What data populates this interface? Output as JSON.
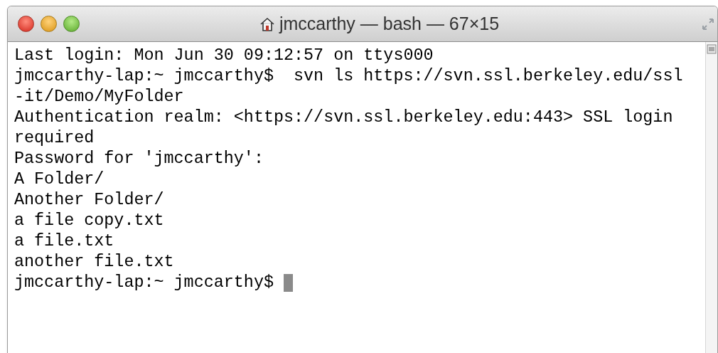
{
  "window": {
    "title": "jmccarthy — bash — 67×15"
  },
  "terminal": {
    "lines": [
      "Last login: Mon Jun 30 09:12:57 on ttys000",
      "jmccarthy-lap:~ jmccarthy$  svn ls https://svn.ssl.berkeley.edu/ssl",
      "-it/Demo/MyFolder",
      "Authentication realm: <https://svn.ssl.berkeley.edu:443> SSL login",
      "required",
      "Password for 'jmccarthy':",
      "A Folder/",
      "Another Folder/",
      "a file copy.txt",
      "a file.txt",
      "another file.txt"
    ],
    "prompt": "jmccarthy-lap:~ jmccarthy$ "
  }
}
